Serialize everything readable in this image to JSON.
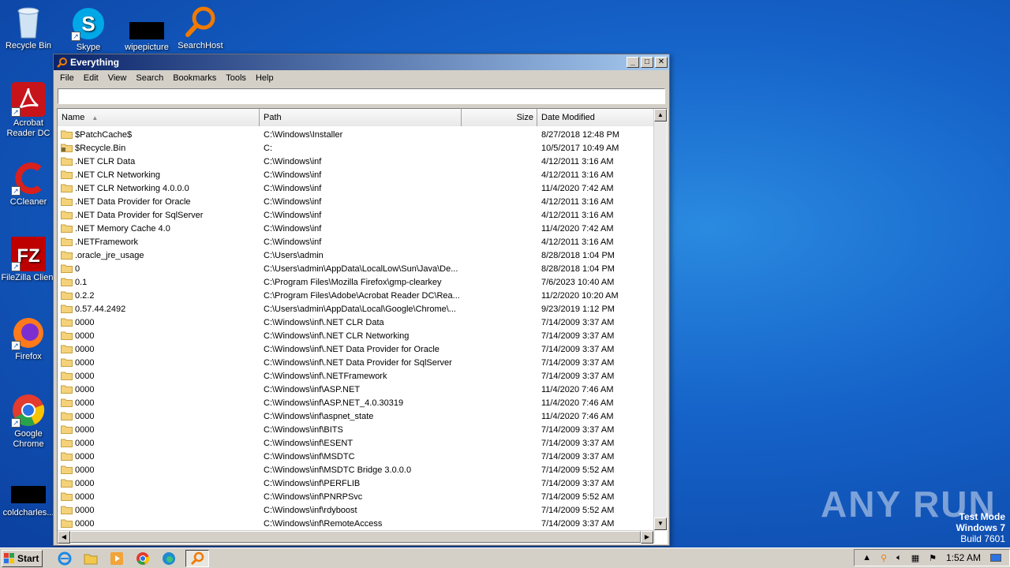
{
  "desktop": {
    "icons": [
      {
        "label": "Recycle Bin"
      },
      {
        "label": "Skype"
      },
      {
        "label": "wipepicture"
      },
      {
        "label": "SearchHost"
      },
      {
        "label": "Acrobat Reader DC"
      },
      {
        "label": "CCleaner"
      },
      {
        "label": "FileZilla Client"
      },
      {
        "label": "Firefox"
      },
      {
        "label": "Google Chrome"
      },
      {
        "label": "coldcharles..."
      }
    ],
    "watermark": "ANY RUN",
    "os_mark": {
      "line1": "Test Mode",
      "line2": "Windows 7",
      "line3": "Build 7601"
    }
  },
  "window": {
    "title": "Everything",
    "menu": [
      "File",
      "Edit",
      "View",
      "Search",
      "Bookmarks",
      "Tools",
      "Help"
    ],
    "search": {
      "value": "",
      "placeholder": ""
    },
    "columns": {
      "name": "Name",
      "path": "Path",
      "size": "Size",
      "date": "Date Modified"
    },
    "rows": [
      {
        "name": "$PatchCache$",
        "path": "C:\\Windows\\Installer",
        "size": "",
        "date": "8/27/2018 12:48 PM"
      },
      {
        "name": "$Recycle.Bin",
        "path": "C:",
        "size": "",
        "date": "10/5/2017 10:49 AM"
      },
      {
        "name": ".NET CLR Data",
        "path": "C:\\Windows\\inf",
        "size": "",
        "date": "4/12/2011 3:16 AM"
      },
      {
        "name": ".NET CLR Networking",
        "path": "C:\\Windows\\inf",
        "size": "",
        "date": "4/12/2011 3:16 AM"
      },
      {
        "name": ".NET CLR Networking 4.0.0.0",
        "path": "C:\\Windows\\inf",
        "size": "",
        "date": "11/4/2020 7:42 AM"
      },
      {
        "name": ".NET Data Provider for Oracle",
        "path": "C:\\Windows\\inf",
        "size": "",
        "date": "4/12/2011 3:16 AM"
      },
      {
        "name": ".NET Data Provider for SqlServer",
        "path": "C:\\Windows\\inf",
        "size": "",
        "date": "4/12/2011 3:16 AM"
      },
      {
        "name": ".NET Memory Cache 4.0",
        "path": "C:\\Windows\\inf",
        "size": "",
        "date": "11/4/2020 7:42 AM"
      },
      {
        "name": ".NETFramework",
        "path": "C:\\Windows\\inf",
        "size": "",
        "date": "4/12/2011 3:16 AM"
      },
      {
        "name": ".oracle_jre_usage",
        "path": "C:\\Users\\admin",
        "size": "",
        "date": "8/28/2018 1:04 PM"
      },
      {
        "name": "0",
        "path": "C:\\Users\\admin\\AppData\\LocalLow\\Sun\\Java\\De...",
        "size": "",
        "date": "8/28/2018 1:04 PM"
      },
      {
        "name": "0.1",
        "path": "C:\\Program Files\\Mozilla Firefox\\gmp-clearkey",
        "size": "",
        "date": "7/6/2023 10:40 AM"
      },
      {
        "name": "0.2.2",
        "path": "C:\\Program Files\\Adobe\\Acrobat Reader DC\\Rea...",
        "size": "",
        "date": "11/2/2020 10:20 AM"
      },
      {
        "name": "0.57.44.2492",
        "path": "C:\\Users\\admin\\AppData\\Local\\Google\\Chrome\\...",
        "size": "",
        "date": "9/23/2019 1:12 PM"
      },
      {
        "name": "0000",
        "path": "C:\\Windows\\inf\\.NET CLR Data",
        "size": "",
        "date": "7/14/2009 3:37 AM"
      },
      {
        "name": "0000",
        "path": "C:\\Windows\\inf\\.NET CLR Networking",
        "size": "",
        "date": "7/14/2009 3:37 AM"
      },
      {
        "name": "0000",
        "path": "C:\\Windows\\inf\\.NET Data Provider for Oracle",
        "size": "",
        "date": "7/14/2009 3:37 AM"
      },
      {
        "name": "0000",
        "path": "C:\\Windows\\inf\\.NET Data Provider for SqlServer",
        "size": "",
        "date": "7/14/2009 3:37 AM"
      },
      {
        "name": "0000",
        "path": "C:\\Windows\\inf\\.NETFramework",
        "size": "",
        "date": "7/14/2009 3:37 AM"
      },
      {
        "name": "0000",
        "path": "C:\\Windows\\inf\\ASP.NET",
        "size": "",
        "date": "11/4/2020 7:46 AM"
      },
      {
        "name": "0000",
        "path": "C:\\Windows\\inf\\ASP.NET_4.0.30319",
        "size": "",
        "date": "11/4/2020 7:46 AM"
      },
      {
        "name": "0000",
        "path": "C:\\Windows\\inf\\aspnet_state",
        "size": "",
        "date": "11/4/2020 7:46 AM"
      },
      {
        "name": "0000",
        "path": "C:\\Windows\\inf\\BITS",
        "size": "",
        "date": "7/14/2009 3:37 AM"
      },
      {
        "name": "0000",
        "path": "C:\\Windows\\inf\\ESENT",
        "size": "",
        "date": "7/14/2009 3:37 AM"
      },
      {
        "name": "0000",
        "path": "C:\\Windows\\inf\\MSDTC",
        "size": "",
        "date": "7/14/2009 3:37 AM"
      },
      {
        "name": "0000",
        "path": "C:\\Windows\\inf\\MSDTC Bridge 3.0.0.0",
        "size": "",
        "date": "7/14/2009 5:52 AM"
      },
      {
        "name": "0000",
        "path": "C:\\Windows\\inf\\PERFLIB",
        "size": "",
        "date": "7/14/2009 3:37 AM"
      },
      {
        "name": "0000",
        "path": "C:\\Windows\\inf\\PNRPSvc",
        "size": "",
        "date": "7/14/2009 5:52 AM"
      },
      {
        "name": "0000",
        "path": "C:\\Windows\\inf\\rdyboost",
        "size": "",
        "date": "7/14/2009 5:52 AM"
      },
      {
        "name": "0000",
        "path": "C:\\Windows\\inf\\RemoteAccess",
        "size": "",
        "date": "7/14/2009 3:37 AM"
      }
    ]
  },
  "taskbar": {
    "start_label": "Start",
    "apps": [
      "internet-explorer",
      "file-explorer",
      "media-player",
      "chrome",
      "edge",
      "everything"
    ],
    "clock": "1:52 AM"
  }
}
